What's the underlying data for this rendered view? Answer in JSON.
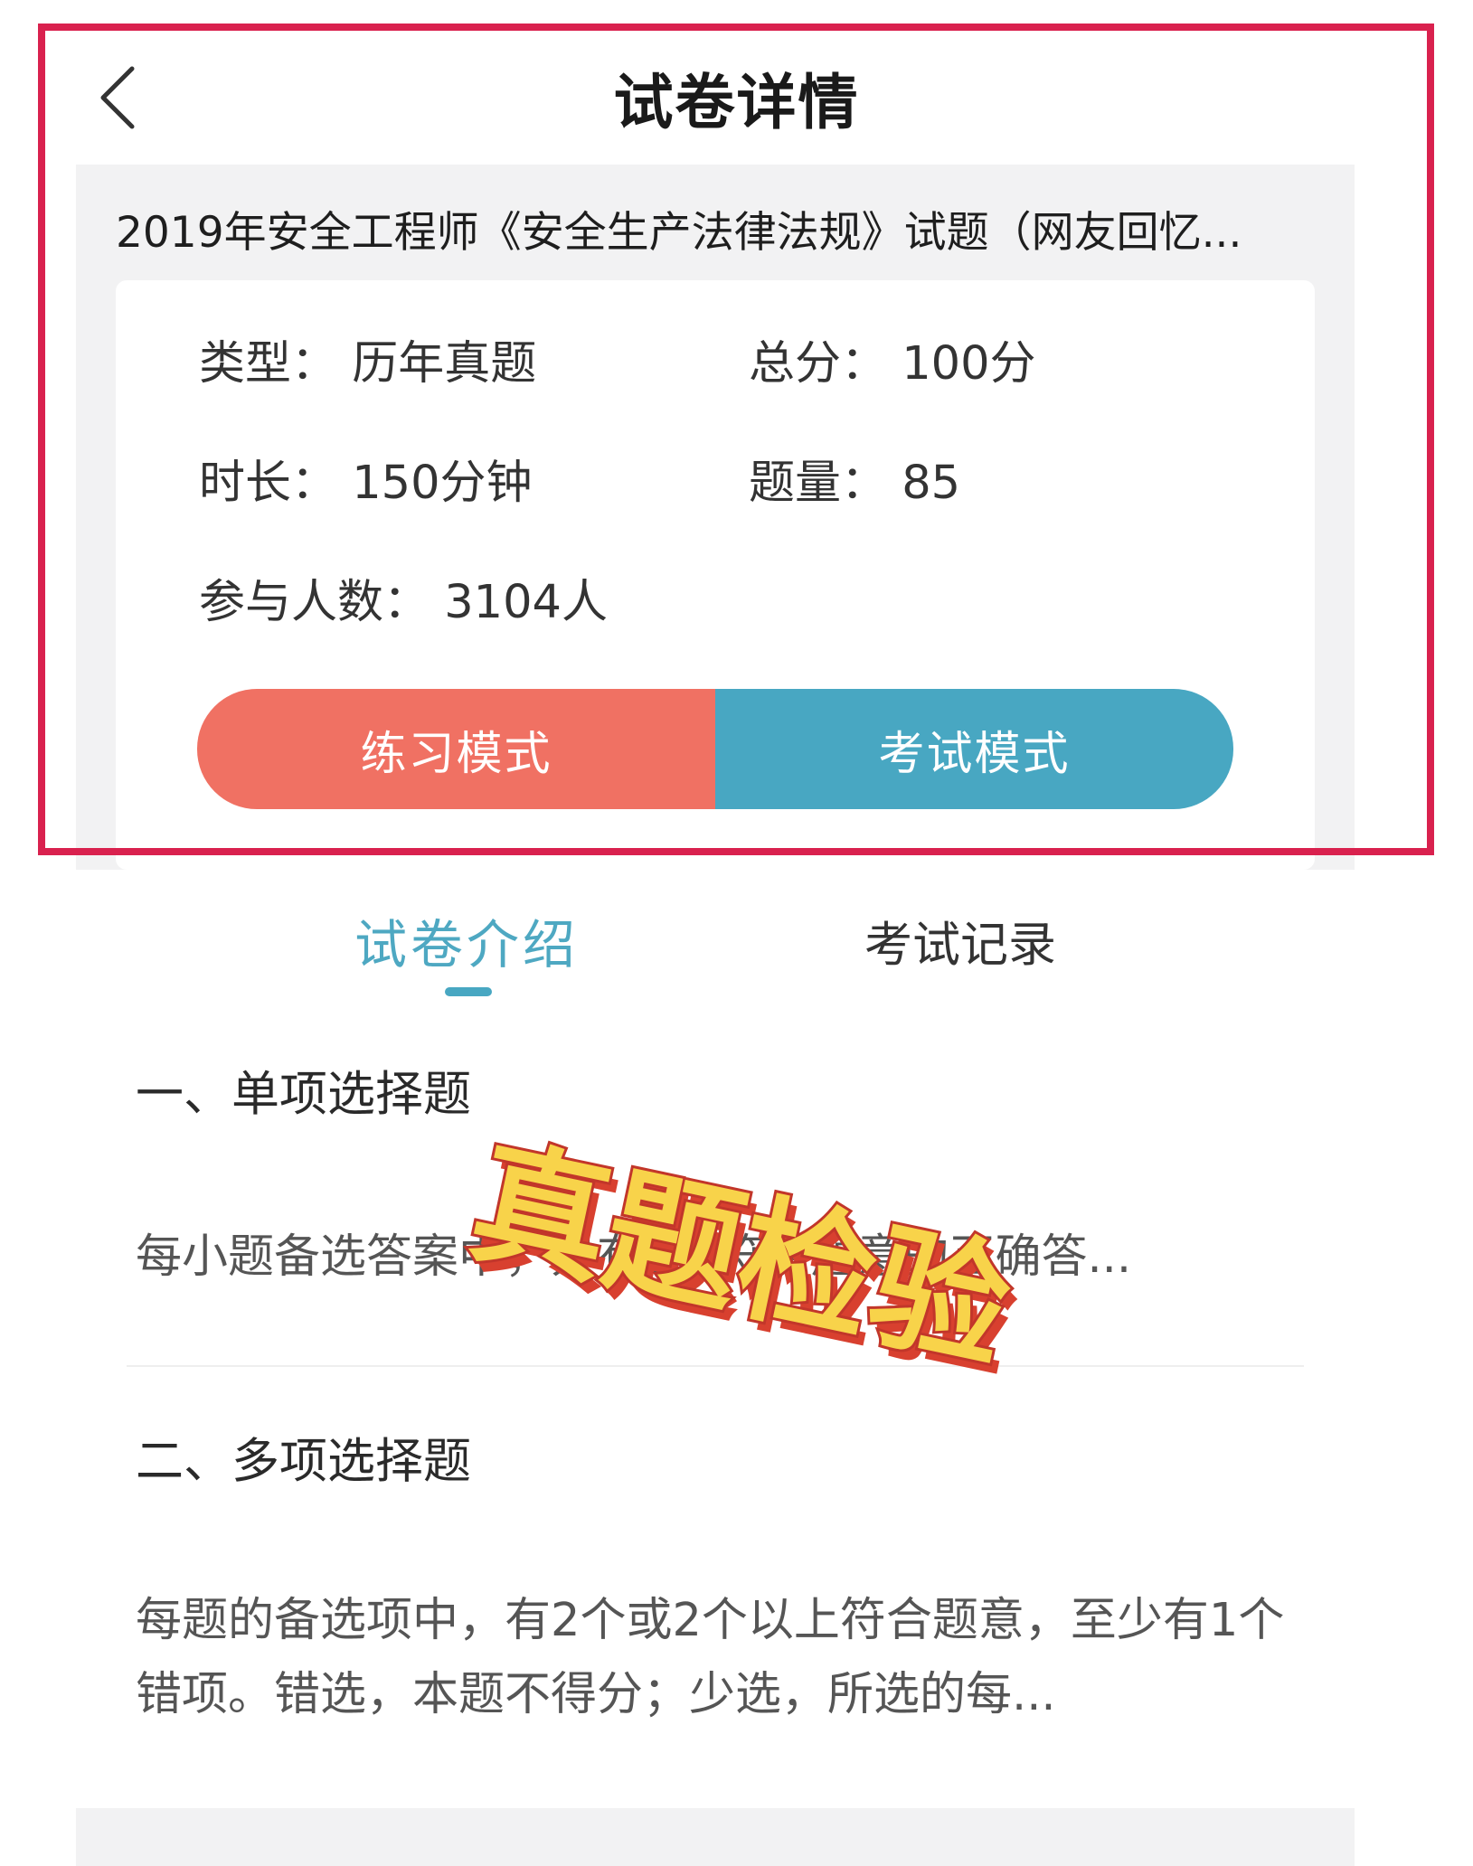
{
  "header": {
    "title": "试卷详情",
    "back_icon": "chevron-left-icon"
  },
  "paper": {
    "title": "2019年安全工程师《安全生产法律法规》试题（网友回忆..."
  },
  "info": {
    "type": "类型：  历年真题",
    "score": "总分：  100分",
    "duration": "时长：  150分钟",
    "question_count": "题量：  85",
    "participants": "参与人数：  3104人"
  },
  "modes": {
    "practice_label": "练习模式",
    "exam_label": "考试模式",
    "practice_color": "#f07163",
    "exam_color": "#48a7c2"
  },
  "tabs": {
    "intro_label": "试卷介绍",
    "record_label": "考试记录",
    "active": "intro",
    "active_color": "#48a7c2"
  },
  "sections": [
    {
      "title": "一、单项选择题",
      "desc": "每小题备选答案中，只有1个符合题意的正确答..."
    },
    {
      "title": "二、多项选择题",
      "desc": "每题的备选项中，有2个或2个以上符合题意，至少有1个错项。错选，本题不得分；少选，所选的每..."
    }
  ],
  "sticker": {
    "text": "真题检验"
  },
  "annotation": {
    "frame_color": "#d9214e"
  }
}
